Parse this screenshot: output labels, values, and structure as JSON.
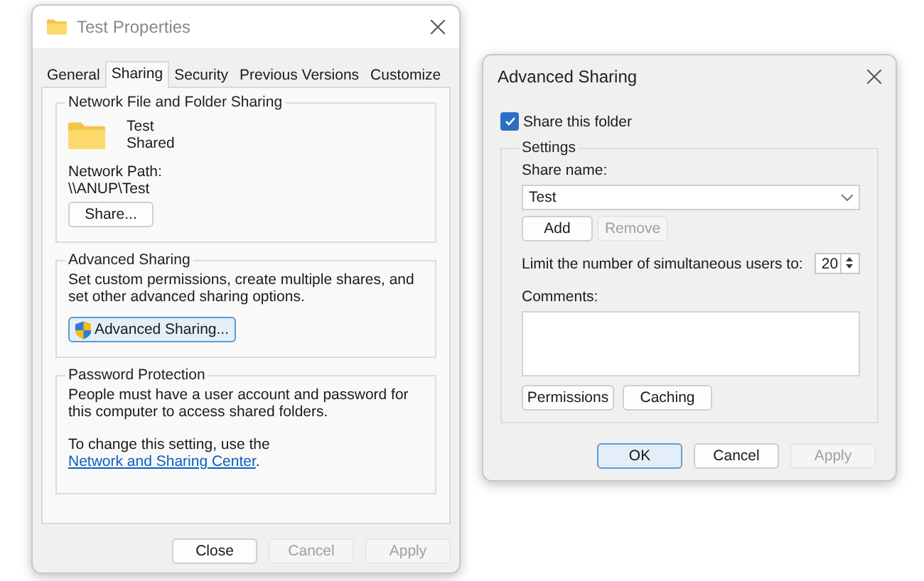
{
  "properties_window": {
    "title": "Test Properties",
    "tabs": [
      {
        "label": "General",
        "selected": false
      },
      {
        "label": "Sharing",
        "selected": true
      },
      {
        "label": "Security",
        "selected": false
      },
      {
        "label": "Previous Versions",
        "selected": false
      },
      {
        "label": "Customize",
        "selected": false
      }
    ],
    "network_sharing": {
      "heading": "Network File and Folder Sharing",
      "name": "Test",
      "status": "Shared",
      "path_label": "Network Path:",
      "path": "\\\\ANUP\\Test",
      "button": "Share..."
    },
    "advanced_sharing": {
      "heading": "Advanced Sharing",
      "description": "Set custom permissions, create multiple shares, and set other advanced sharing options.",
      "button": "Advanced Sharing..."
    },
    "password_protection": {
      "heading": "Password Protection",
      "description": "People must have a user account and password for this computer to access shared folders.",
      "link_prefix": "To change this setting, use the",
      "link": "Network and Sharing Center",
      "link_suffix": "."
    },
    "buttons": [
      {
        "label": "Close",
        "disabled": false
      },
      {
        "label": "Cancel",
        "disabled": true
      },
      {
        "label": "Apply",
        "disabled": true
      }
    ]
  },
  "advanced_window": {
    "title": "Advanced Sharing",
    "share_checkbox": {
      "label": "Share this folder",
      "checked": true
    },
    "settings": {
      "heading": "Settings",
      "share_name_label": "Share name:",
      "share_name": "Test",
      "name_buttons": [
        {
          "label": "Add",
          "disabled": false
        },
        {
          "label": "Remove",
          "disabled": true
        }
      ],
      "limit_label": "Limit the number of simultaneous users to:",
      "limit_value": "20",
      "comments_label": "Comments:",
      "buttons": [
        {
          "label": "Permissions",
          "disabled": false
        },
        {
          "label": "Caching",
          "disabled": false
        }
      ]
    },
    "buttons": [
      {
        "label": "OK",
        "disabled": false,
        "default": true
      },
      {
        "label": "Cancel",
        "disabled": false,
        "default": false
      },
      {
        "label": "Apply",
        "disabled": true,
        "default": false
      }
    ]
  }
}
